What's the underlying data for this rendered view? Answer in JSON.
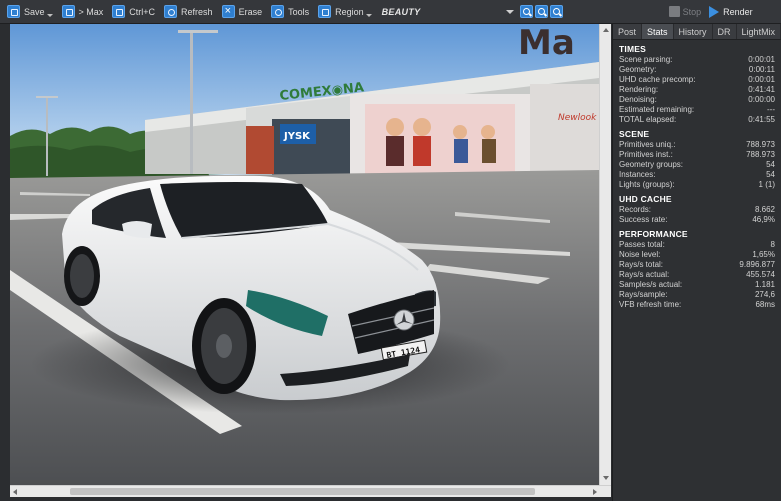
{
  "toolbar": {
    "save": "Save",
    "max": "> Max",
    "copy": "Ctrl+C",
    "refresh": "Refresh",
    "erase": "Erase",
    "tools": "Tools",
    "region": "Region",
    "channel": "BEAUTY",
    "stop": "Stop",
    "render": "Render"
  },
  "tabs": [
    "Post",
    "Stats",
    "History",
    "DR",
    "LightMix"
  ],
  "sections": [
    {
      "title": "TIMES",
      "rows": [
        [
          "Scene parsing:",
          "0:00:01"
        ],
        [
          "Geometry:",
          "0:00:11"
        ],
        [
          "UHD cache precomp:",
          "0:00:01"
        ],
        [
          "Rendering:",
          "0:41:41"
        ],
        [
          "Denoising:",
          "0:00:00"
        ],
        [
          "Estimated remaining:",
          "---"
        ],
        [
          "TOTAL elapsed:",
          "0:41:55"
        ]
      ]
    },
    {
      "title": "SCENE",
      "rows": [
        [
          "Primitives uniq.:",
          "788.973"
        ],
        [
          "Primitives inst.:",
          "788.973"
        ],
        [
          "Geometry groups:",
          "54"
        ],
        [
          "Instances:",
          "54"
        ],
        [
          "Lights (groups):",
          "1 (1)"
        ]
      ]
    },
    {
      "title": "UHD CACHE",
      "rows": [
        [
          "Records:",
          "8.662"
        ],
        [
          "Success rate:",
          "46,9%"
        ]
      ]
    },
    {
      "title": "PERFORMANCE",
      "rows": [
        [
          "Passes total:",
          "8"
        ],
        [
          "Noise level:",
          "1,65%"
        ],
        [
          "Rays/s total:",
          "9.896.877"
        ],
        [
          "Rays/s actual:",
          "455.574"
        ],
        [
          "Samples/s actual:",
          "1.181"
        ],
        [
          "Rays/sample:",
          "274,6"
        ],
        [
          "VFB refresh time:",
          "68ms"
        ]
      ]
    }
  ],
  "scene": {
    "store_sign": "COMEX◉NA",
    "sysk_sign": "JYSK",
    "right_sign": "Newlook",
    "top_letters": "Ma",
    "plate": "BT 1124"
  }
}
